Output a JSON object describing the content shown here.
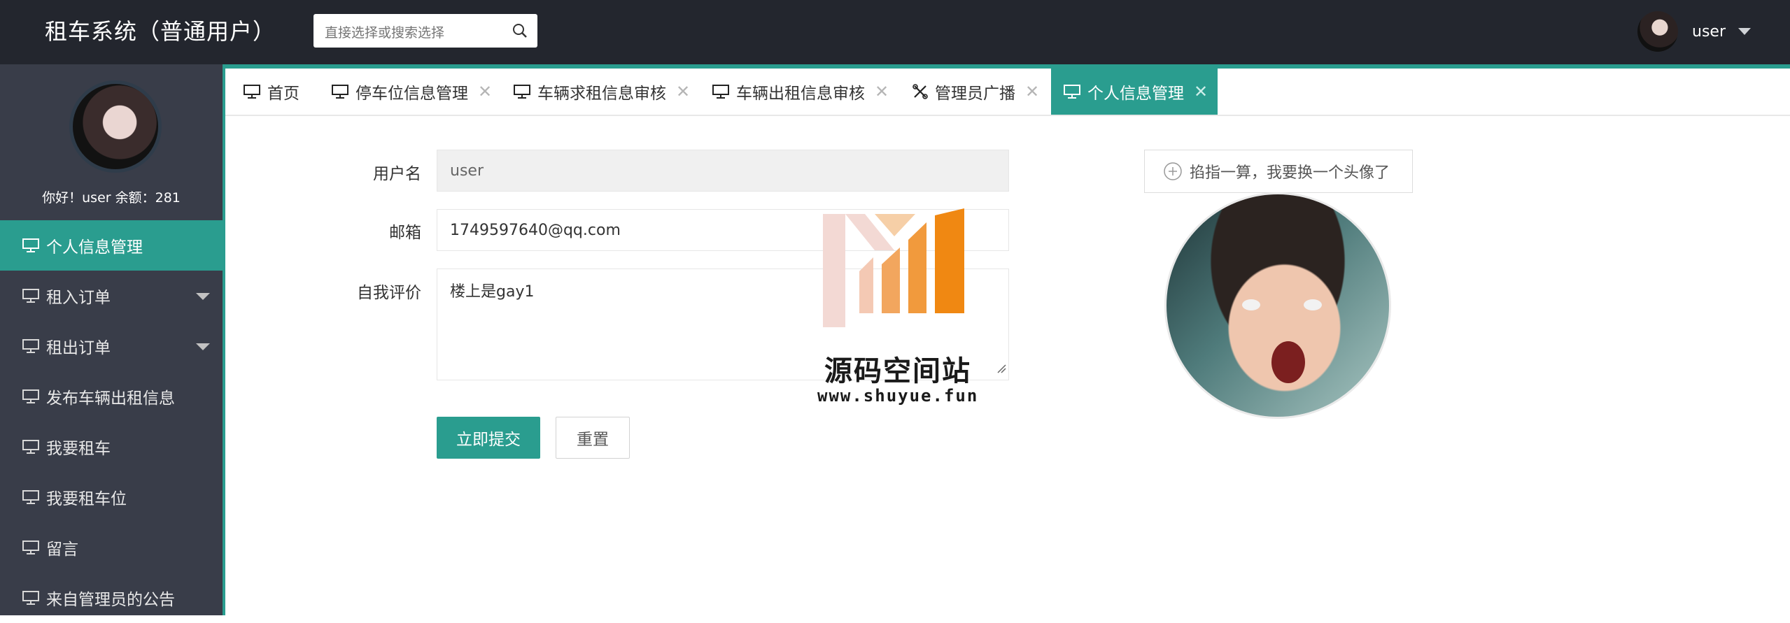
{
  "header": {
    "app_title": "租车系统（普通用户）",
    "search_placeholder": "直接选择或搜索选择",
    "username": "user"
  },
  "sidebar": {
    "greeting": "你好！user 余额：281",
    "items": [
      {
        "label": "个人信息管理",
        "active": true
      },
      {
        "label": "租入订单",
        "expandable": true
      },
      {
        "label": "租出订单",
        "expandable": true
      },
      {
        "label": "发布车辆出租信息"
      },
      {
        "label": "我要租车"
      },
      {
        "label": "我要租车位"
      },
      {
        "label": "留言"
      },
      {
        "label": "来自管理员的公告"
      }
    ]
  },
  "tabs": [
    {
      "label": "首页",
      "icon": "monitor-icon"
    },
    {
      "label": "停车位信息管理",
      "icon": "monitor-icon"
    },
    {
      "label": "车辆求租信息审核",
      "icon": "monitor-icon"
    },
    {
      "label": "车辆出租信息审核",
      "icon": "monitor-icon"
    },
    {
      "label": "管理员广播",
      "icon": "tools-icon"
    },
    {
      "label": "个人信息管理",
      "icon": "monitor-icon",
      "active": true
    }
  ],
  "form": {
    "username_label": "用户名",
    "username_value": "user",
    "email_label": "邮箱",
    "email_value": "1749597640@qq.com",
    "bio_label": "自我评价",
    "bio_value": "楼上是gay1",
    "submit_label": "立即提交",
    "reset_label": "重置"
  },
  "upload": {
    "button_label": "掐指一算，我要换一个头像了"
  },
  "watermark": {
    "title": "源码空间站",
    "url": "www.shuyue.fun"
  },
  "colors": {
    "header_bg": "#23262e",
    "sidebar_bg": "#393d49",
    "accent": "#2a9d8f"
  }
}
